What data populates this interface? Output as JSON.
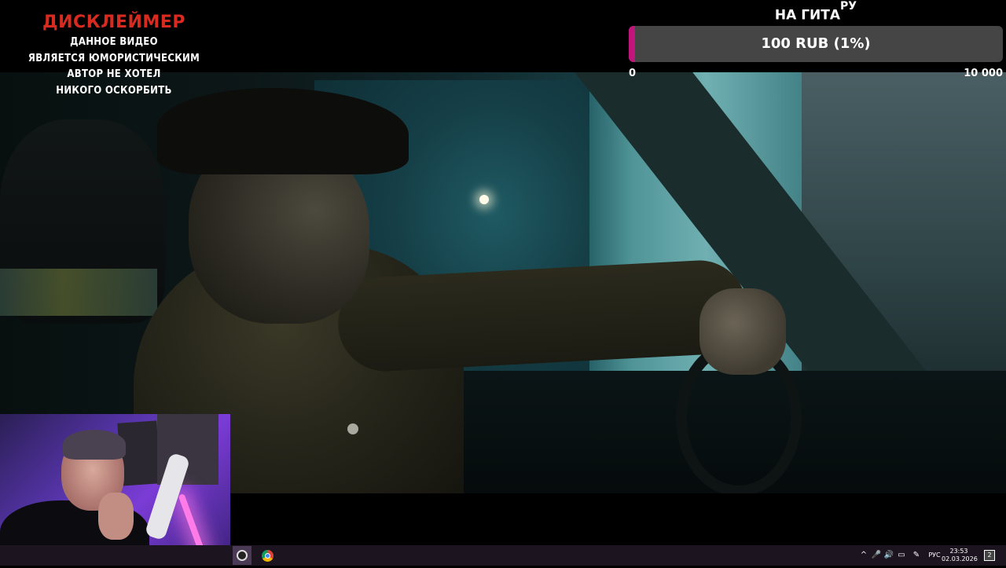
{
  "disclaimer": {
    "title": "ДИСКЛЕЙМЕР",
    "lines": [
      "ДАННОЕ ВИДЕО",
      "ЯВЛЯЕТСЯ ЮМОРИСТИЧЕСКИМ",
      "АВТОР НЕ ХОТЕЛ",
      "НИКОГО ОСКОРБИТЬ"
    ]
  },
  "goal": {
    "title": "НА ГИТА",
    "title_sup": "РУ",
    "amount": "100 RUB (1%)",
    "progress_percent": 1,
    "min_label": "0",
    "max_label": "10 000",
    "fill_color": "#c0157a"
  },
  "taskbar": {
    "apps": [
      "obs-icon",
      "chrome-icon"
    ],
    "tray": {
      "chevron": "^",
      "mic": "🎤",
      "volume": "🔊",
      "network": "▭",
      "pen": "✎",
      "language": "РУС",
      "time": "23:53",
      "date": "02.03.2026",
      "notification_count": "2"
    }
  }
}
